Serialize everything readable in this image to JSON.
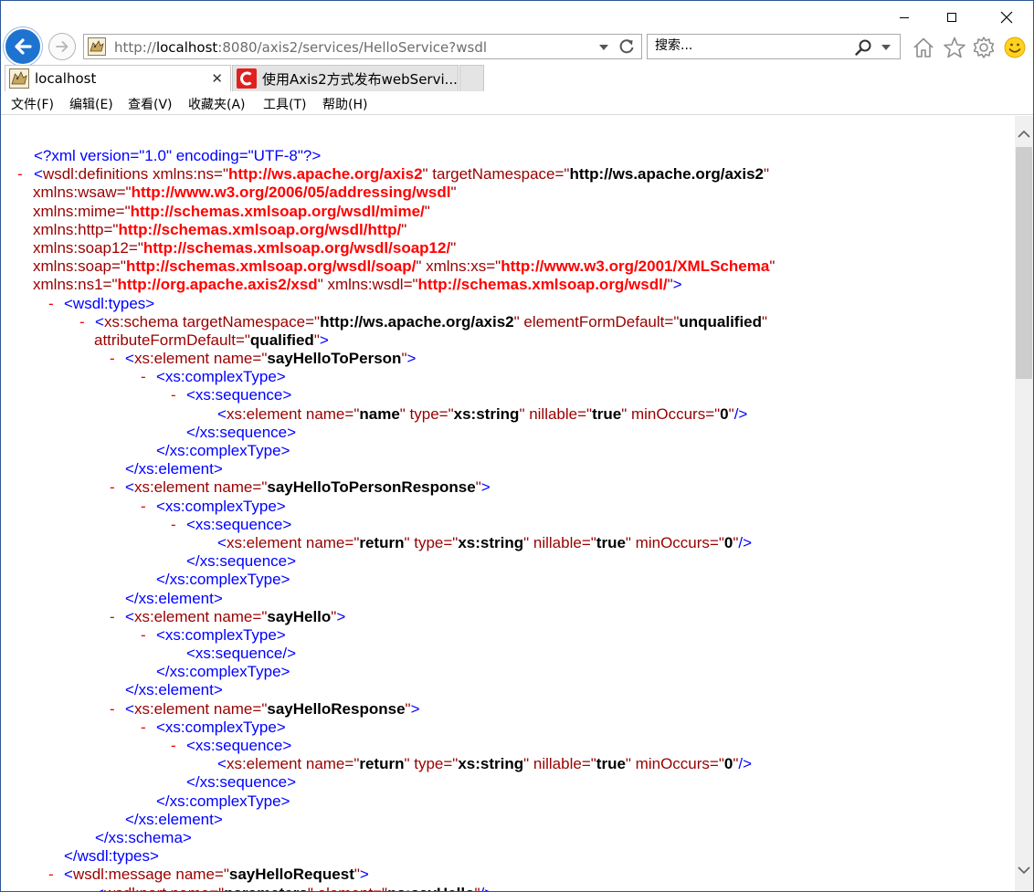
{
  "window": {
    "controls": {
      "minimize": "─",
      "maximize": "☐",
      "close": "✕"
    }
  },
  "toolbar": {
    "address": {
      "prefix": "http://",
      "host": "localhost",
      "path": ":8080/axis2/services/HelloService?wsdl"
    },
    "search_placeholder": "搜索...",
    "icons": [
      "back-arrow-icon",
      "forward-arrow-icon",
      "refresh-icon",
      "search-icon",
      "home-icon",
      "favorites-star-icon",
      "gear-icon",
      "smiley-icon"
    ]
  },
  "tabs": [
    {
      "label": "localhost",
      "active": true,
      "close": "✕"
    },
    {
      "label": "使用Axis2方式发布webServi...",
      "active": false
    }
  ],
  "menu": [
    {
      "label": "文件(F)"
    },
    {
      "label": "编辑(E)"
    },
    {
      "label": "查看(V)"
    },
    {
      "label": "收藏夹(A)"
    },
    {
      "label": "工具(T)"
    },
    {
      "label": "帮助(H)"
    }
  ],
  "colors": {
    "tag": "#0000ff",
    "attr": "#990000",
    "value": "#000000",
    "ns_value": "#ff0000",
    "collapse": "#ee0000",
    "back_button": "#1e73d1"
  },
  "xml_lines": [
    {
      "indent": 0,
      "minus": false,
      "parts": [
        {
          "c": "blue",
          "t": "<?xml version=\"1.0\" encoding=\"UTF-8\"?>"
        }
      ]
    },
    {
      "indent": 0,
      "minus": true,
      "parts": [
        {
          "c": "blue",
          "t": "<"
        },
        {
          "c": "attr",
          "t": "wsdl:definitions xmlns:ns=\""
        },
        {
          "c": "red",
          "t": "http://ws.apache.org/axis2"
        },
        {
          "c": "attr",
          "t": "\" targetNamespace=\""
        },
        {
          "c": "black",
          "t": "http://ws.apache.org/axis2"
        },
        {
          "c": "attr",
          "t": "\""
        }
      ]
    },
    {
      "indent": 0,
      "minus": false,
      "cont": true,
      "parts": [
        {
          "c": "attr",
          "t": "xmlns:wsaw=\""
        },
        {
          "c": "red",
          "t": "http://www.w3.org/2006/05/addressing/wsdl"
        },
        {
          "c": "attr",
          "t": "\""
        }
      ]
    },
    {
      "indent": 0,
      "minus": false,
      "cont": true,
      "parts": [
        {
          "c": "attr",
          "t": "xmlns:mime=\""
        },
        {
          "c": "red",
          "t": "http://schemas.xmlsoap.org/wsdl/mime/"
        },
        {
          "c": "attr",
          "t": "\""
        }
      ]
    },
    {
      "indent": 0,
      "minus": false,
      "cont": true,
      "parts": [
        {
          "c": "attr",
          "t": "xmlns:http=\""
        },
        {
          "c": "red",
          "t": "http://schemas.xmlsoap.org/wsdl/http/"
        },
        {
          "c": "attr",
          "t": "\""
        }
      ]
    },
    {
      "indent": 0,
      "minus": false,
      "cont": true,
      "parts": [
        {
          "c": "attr",
          "t": "xmlns:soap12=\""
        },
        {
          "c": "red",
          "t": "http://schemas.xmlsoap.org/wsdl/soap12/"
        },
        {
          "c": "attr",
          "t": "\""
        }
      ]
    },
    {
      "indent": 0,
      "minus": false,
      "cont": true,
      "parts": [
        {
          "c": "attr",
          "t": "xmlns:soap=\""
        },
        {
          "c": "red",
          "t": "http://schemas.xmlsoap.org/wsdl/soap/"
        },
        {
          "c": "attr",
          "t": "\" xmlns:xs=\""
        },
        {
          "c": "red",
          "t": "http://www.w3.org/2001/XMLSchema"
        },
        {
          "c": "attr",
          "t": "\""
        }
      ]
    },
    {
      "indent": 0,
      "minus": false,
      "cont": true,
      "parts": [
        {
          "c": "attr",
          "t": "xmlns:ns1=\""
        },
        {
          "c": "red",
          "t": "http://org.apache.axis2/xsd"
        },
        {
          "c": "attr",
          "t": "\" xmlns:wsdl=\""
        },
        {
          "c": "red",
          "t": "http://schemas.xmlsoap.org/wsdl/"
        },
        {
          "c": "attr",
          "t": "\""
        },
        {
          "c": "blue",
          "t": ">"
        }
      ]
    },
    {
      "indent": 1,
      "minus": true,
      "parts": [
        {
          "c": "blue",
          "t": "<wsdl:types>"
        }
      ]
    },
    {
      "indent": 2,
      "minus": true,
      "parts": [
        {
          "c": "blue",
          "t": "<"
        },
        {
          "c": "attr",
          "t": "xs:schema targetNamespace=\""
        },
        {
          "c": "black",
          "t": "http://ws.apache.org/axis2"
        },
        {
          "c": "attr",
          "t": "\" elementFormDefault=\""
        },
        {
          "c": "black",
          "t": "unqualified"
        },
        {
          "c": "attr",
          "t": "\""
        }
      ]
    },
    {
      "indent": 2,
      "minus": false,
      "cont": true,
      "parts": [
        {
          "c": "attr",
          "t": "attributeFormDefault=\""
        },
        {
          "c": "black",
          "t": "qualified"
        },
        {
          "c": "attr",
          "t": "\""
        },
        {
          "c": "blue",
          "t": ">"
        }
      ]
    },
    {
      "indent": 3,
      "minus": true,
      "parts": [
        {
          "c": "blue",
          "t": "<"
        },
        {
          "c": "attr",
          "t": "xs:element name=\""
        },
        {
          "c": "black",
          "t": "sayHelloToPerson"
        },
        {
          "c": "attr",
          "t": "\""
        },
        {
          "c": "blue",
          "t": ">"
        }
      ]
    },
    {
      "indent": 4,
      "minus": true,
      "parts": [
        {
          "c": "blue",
          "t": "<xs:complexType>"
        }
      ]
    },
    {
      "indent": 5,
      "minus": true,
      "parts": [
        {
          "c": "blue",
          "t": "<xs:sequence>"
        }
      ]
    },
    {
      "indent": 6,
      "minus": false,
      "parts": [
        {
          "c": "blue",
          "t": "<"
        },
        {
          "c": "attr",
          "t": "xs:element name=\""
        },
        {
          "c": "black",
          "t": "name"
        },
        {
          "c": "attr",
          "t": "\" type=\""
        },
        {
          "c": "black",
          "t": "xs:string"
        },
        {
          "c": "attr",
          "t": "\" nillable=\""
        },
        {
          "c": "black",
          "t": "true"
        },
        {
          "c": "attr",
          "t": "\" minOccurs=\""
        },
        {
          "c": "black",
          "t": "0"
        },
        {
          "c": "attr",
          "t": "\""
        },
        {
          "c": "blue",
          "t": "/>"
        }
      ]
    },
    {
      "indent": 5,
      "minus": false,
      "parts": [
        {
          "c": "blue",
          "t": "</xs:sequence>"
        }
      ]
    },
    {
      "indent": 4,
      "minus": false,
      "parts": [
        {
          "c": "blue",
          "t": "</xs:complexType>"
        }
      ]
    },
    {
      "indent": 3,
      "minus": false,
      "parts": [
        {
          "c": "blue",
          "t": "</xs:element>"
        }
      ]
    },
    {
      "indent": 3,
      "minus": true,
      "parts": [
        {
          "c": "blue",
          "t": "<"
        },
        {
          "c": "attr",
          "t": "xs:element name=\""
        },
        {
          "c": "black",
          "t": "sayHelloToPersonResponse"
        },
        {
          "c": "attr",
          "t": "\""
        },
        {
          "c": "blue",
          "t": ">"
        }
      ]
    },
    {
      "indent": 4,
      "minus": true,
      "parts": [
        {
          "c": "blue",
          "t": "<xs:complexType>"
        }
      ]
    },
    {
      "indent": 5,
      "minus": true,
      "parts": [
        {
          "c": "blue",
          "t": "<xs:sequence>"
        }
      ]
    },
    {
      "indent": 6,
      "minus": false,
      "parts": [
        {
          "c": "blue",
          "t": "<"
        },
        {
          "c": "attr",
          "t": "xs:element name=\""
        },
        {
          "c": "black",
          "t": "return"
        },
        {
          "c": "attr",
          "t": "\" type=\""
        },
        {
          "c": "black",
          "t": "xs:string"
        },
        {
          "c": "attr",
          "t": "\" nillable=\""
        },
        {
          "c": "black",
          "t": "true"
        },
        {
          "c": "attr",
          "t": "\" minOccurs=\""
        },
        {
          "c": "black",
          "t": "0"
        },
        {
          "c": "attr",
          "t": "\""
        },
        {
          "c": "blue",
          "t": "/>"
        }
      ]
    },
    {
      "indent": 5,
      "minus": false,
      "parts": [
        {
          "c": "blue",
          "t": "</xs:sequence>"
        }
      ]
    },
    {
      "indent": 4,
      "minus": false,
      "parts": [
        {
          "c": "blue",
          "t": "</xs:complexType>"
        }
      ]
    },
    {
      "indent": 3,
      "minus": false,
      "parts": [
        {
          "c": "blue",
          "t": "</xs:element>"
        }
      ]
    },
    {
      "indent": 3,
      "minus": true,
      "parts": [
        {
          "c": "blue",
          "t": "<"
        },
        {
          "c": "attr",
          "t": "xs:element name=\""
        },
        {
          "c": "black",
          "t": "sayHello"
        },
        {
          "c": "attr",
          "t": "\""
        },
        {
          "c": "blue",
          "t": ">"
        }
      ]
    },
    {
      "indent": 4,
      "minus": true,
      "parts": [
        {
          "c": "blue",
          "t": "<xs:complexType>"
        }
      ]
    },
    {
      "indent": 5,
      "minus": false,
      "parts": [
        {
          "c": "blue",
          "t": "<xs:sequence/>"
        }
      ]
    },
    {
      "indent": 4,
      "minus": false,
      "parts": [
        {
          "c": "blue",
          "t": "</xs:complexType>"
        }
      ]
    },
    {
      "indent": 3,
      "minus": false,
      "parts": [
        {
          "c": "blue",
          "t": "</xs:element>"
        }
      ]
    },
    {
      "indent": 3,
      "minus": true,
      "parts": [
        {
          "c": "blue",
          "t": "<"
        },
        {
          "c": "attr",
          "t": "xs:element name=\""
        },
        {
          "c": "black",
          "t": "sayHelloResponse"
        },
        {
          "c": "attr",
          "t": "\""
        },
        {
          "c": "blue",
          "t": ">"
        }
      ]
    },
    {
      "indent": 4,
      "minus": true,
      "parts": [
        {
          "c": "blue",
          "t": "<xs:complexType>"
        }
      ]
    },
    {
      "indent": 5,
      "minus": true,
      "parts": [
        {
          "c": "blue",
          "t": "<xs:sequence>"
        }
      ]
    },
    {
      "indent": 6,
      "minus": false,
      "parts": [
        {
          "c": "blue",
          "t": "<"
        },
        {
          "c": "attr",
          "t": "xs:element name=\""
        },
        {
          "c": "black",
          "t": "return"
        },
        {
          "c": "attr",
          "t": "\" type=\""
        },
        {
          "c": "black",
          "t": "xs:string"
        },
        {
          "c": "attr",
          "t": "\" nillable=\""
        },
        {
          "c": "black",
          "t": "true"
        },
        {
          "c": "attr",
          "t": "\" minOccurs=\""
        },
        {
          "c": "black",
          "t": "0"
        },
        {
          "c": "attr",
          "t": "\""
        },
        {
          "c": "blue",
          "t": "/>"
        }
      ]
    },
    {
      "indent": 5,
      "minus": false,
      "parts": [
        {
          "c": "blue",
          "t": "</xs:sequence>"
        }
      ]
    },
    {
      "indent": 4,
      "minus": false,
      "parts": [
        {
          "c": "blue",
          "t": "</xs:complexType>"
        }
      ]
    },
    {
      "indent": 3,
      "minus": false,
      "parts": [
        {
          "c": "blue",
          "t": "</xs:element>"
        }
      ]
    },
    {
      "indent": 2,
      "minus": false,
      "parts": [
        {
          "c": "blue",
          "t": "</xs:schema>"
        }
      ]
    },
    {
      "indent": 1,
      "minus": false,
      "parts": [
        {
          "c": "blue",
          "t": "</wsdl:types>"
        }
      ]
    },
    {
      "indent": 1,
      "minus": true,
      "parts": [
        {
          "c": "blue",
          "t": "<"
        },
        {
          "c": "attr",
          "t": "wsdl:message name=\""
        },
        {
          "c": "black",
          "t": "sayHelloRequest"
        },
        {
          "c": "attr",
          "t": "\""
        },
        {
          "c": "blue",
          "t": ">"
        }
      ]
    },
    {
      "indent": 2,
      "minus": false,
      "parts": [
        {
          "c": "blue",
          "t": "<"
        },
        {
          "c": "attr",
          "t": "wsdl:part name=\""
        },
        {
          "c": "black",
          "t": "parameters"
        },
        {
          "c": "attr",
          "t": "\" element=\""
        },
        {
          "c": "black",
          "t": "ns:sayHello"
        },
        {
          "c": "attr",
          "t": "\""
        },
        {
          "c": "blue",
          "t": "/>"
        }
      ]
    }
  ]
}
